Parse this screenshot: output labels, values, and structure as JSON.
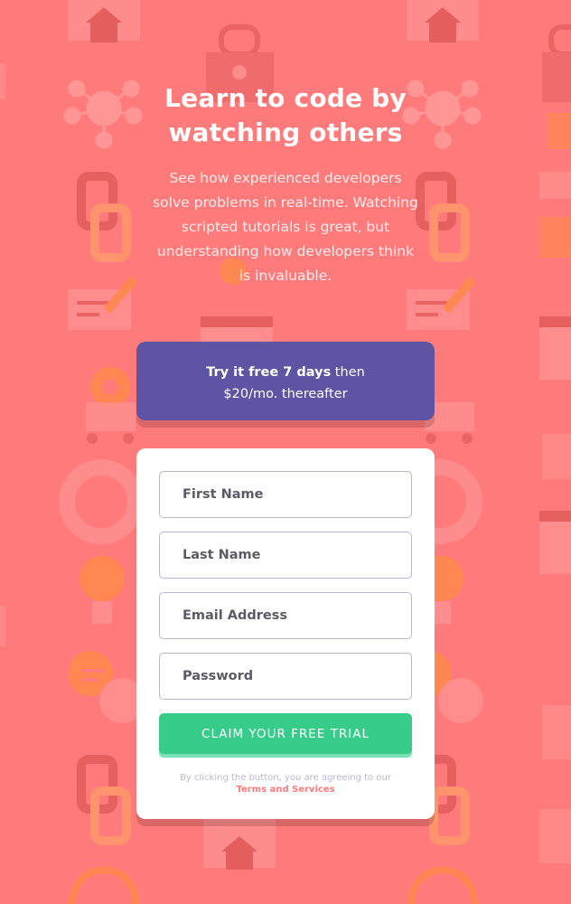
{
  "colors": {
    "background": "#ff7a7a",
    "offer_background": "#5e54a4",
    "cta_background": "#38cc8b",
    "terms_link": "#ff7a7a"
  },
  "hero": {
    "title_line1": "Learn to code by",
    "title_line2": "watching others",
    "description": "See how experienced developers solve problems in real-time. Watching scripted tutorials is great, but understanding how developers think is invaluable."
  },
  "offer": {
    "bold": "Try it free 7 days",
    "rest_line1": " then",
    "line2": "$20/mo. thereafter"
  },
  "form": {
    "first_name_placeholder": "First Name",
    "last_name_placeholder": "Last Name",
    "email_placeholder": "Email Address",
    "password_placeholder": "Password",
    "submit_label": "Claim your free trial",
    "terms_prefix": "By clicking the button, you are agreeing to our",
    "terms_link": "Terms and Services"
  },
  "background_icons": [
    "home-icon",
    "lock-icon",
    "network-icon",
    "chain-link-icon",
    "chat-pencil-icon",
    "browser-window-icon",
    "gear-icon",
    "cart-icon",
    "lifebuoy-icon",
    "lightbulb-icon",
    "chat-bubble-icon",
    "headphones-icon"
  ]
}
